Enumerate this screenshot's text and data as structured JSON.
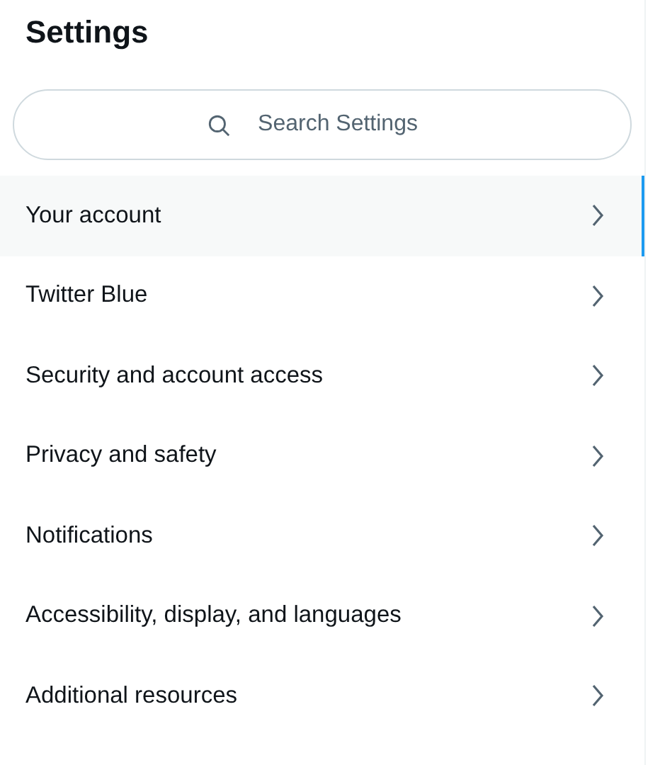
{
  "title": "Settings",
  "search": {
    "placeholder": "Search Settings"
  },
  "items": [
    {
      "label": "Your account",
      "selected": true
    },
    {
      "label": "Twitter Blue",
      "selected": false
    },
    {
      "label": "Security and account access",
      "selected": false
    },
    {
      "label": "Privacy and safety",
      "selected": false
    },
    {
      "label": "Notifications",
      "selected": false
    },
    {
      "label": "Accessibility, display, and languages",
      "selected": false
    },
    {
      "label": "Additional resources",
      "selected": false
    }
  ]
}
